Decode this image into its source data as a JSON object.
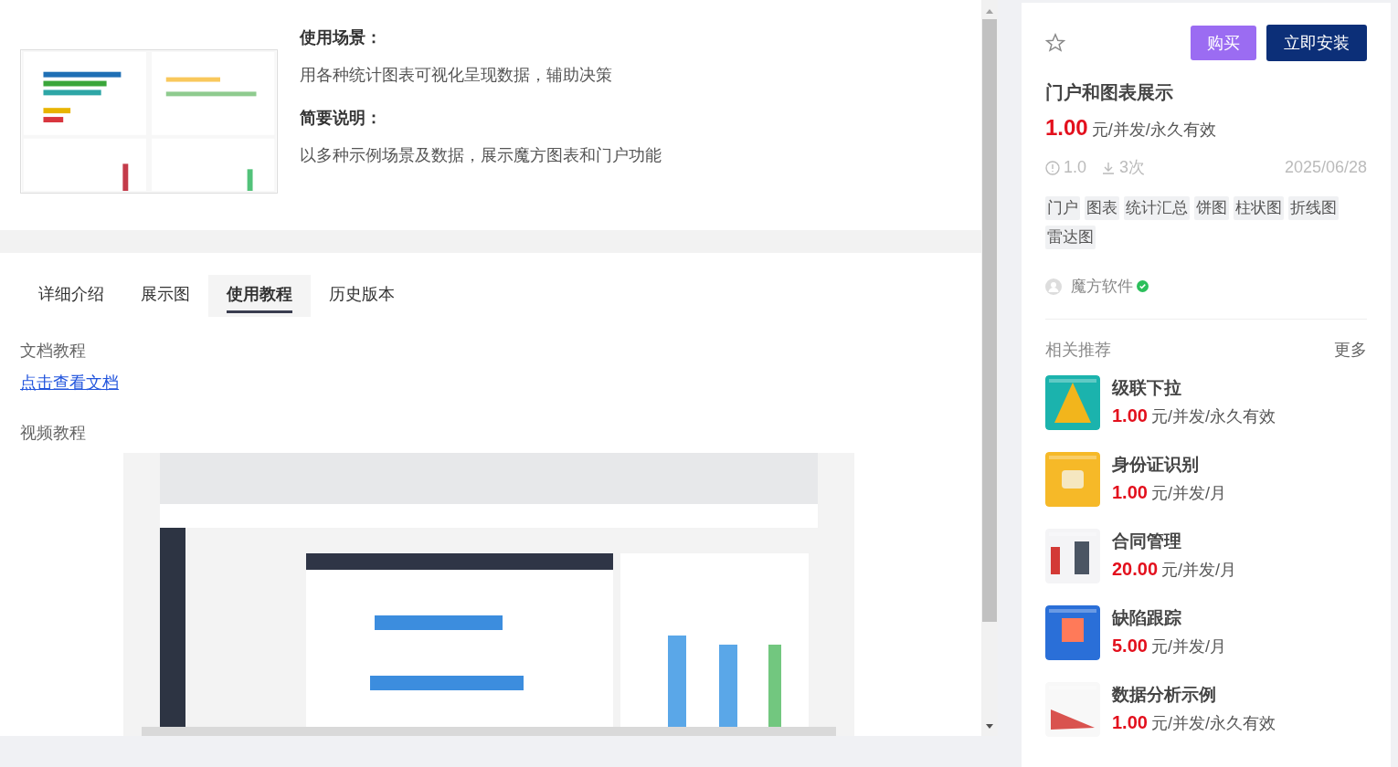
{
  "intro": {
    "usage_heading": "使用场景：",
    "usage_text": "用各种统计图表可视化呈现数据，辅助决策",
    "summary_heading": "简要说明：",
    "summary_text": "以多种示例场景及数据，展示魔方图表和门户功能"
  },
  "tabs": [
    {
      "label": "详细介绍",
      "selected": false
    },
    {
      "label": "展示图",
      "selected": false
    },
    {
      "label": "使用教程",
      "selected": true
    },
    {
      "label": "历史版本",
      "selected": false
    }
  ],
  "tutorial": {
    "doc_heading": "文档教程",
    "doc_link": "点击查看文档",
    "video_heading": "视频教程"
  },
  "product": {
    "buy": "购买",
    "install": "立即安装",
    "title": "门户和图表展示",
    "price": "1.00",
    "unit": "元/并发/永久有效",
    "version": "1.0",
    "downloads": "3次",
    "date": "2025/06/28",
    "tags": [
      "门户",
      "图表",
      "统计汇总",
      "饼图",
      "柱状图",
      "折线图",
      "雷达图"
    ],
    "author": "魔方软件"
  },
  "related": {
    "title": "相关推荐",
    "more": "更多",
    "items": [
      {
        "name": "级联下拉",
        "price": "1.00",
        "unit": "元/并发/永久有效",
        "color": "#1bb3ad"
      },
      {
        "name": "身份证识别",
        "price": "1.00",
        "unit": "元/并发/月",
        "color": "#f6b928"
      },
      {
        "name": "合同管理",
        "price": "20.00",
        "unit": "元/并发/月",
        "color": "#f4f4f6"
      },
      {
        "name": "缺陷跟踪",
        "price": "5.00",
        "unit": "元/并发/月",
        "color": "#2a6fd8"
      },
      {
        "name": "数据分析示例",
        "price": "1.00",
        "unit": "元/并发/永久有效",
        "color": "#f8f8f8"
      }
    ]
  }
}
